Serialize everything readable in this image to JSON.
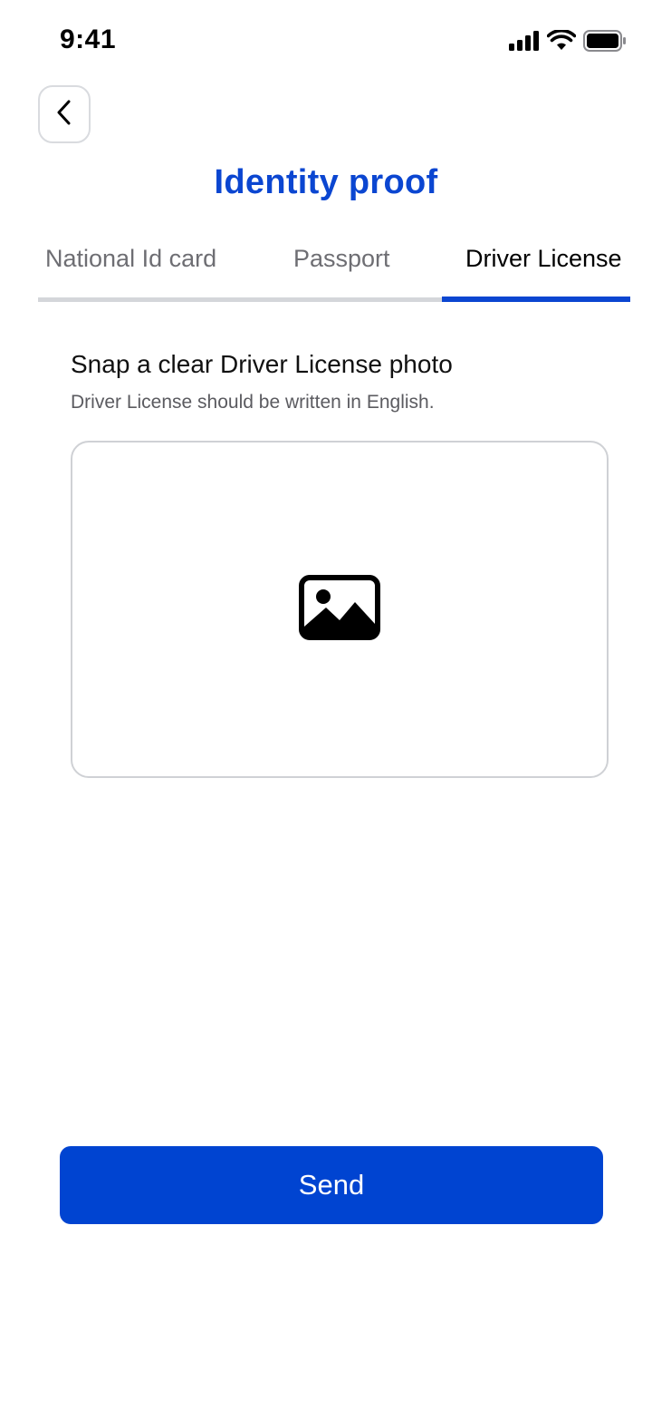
{
  "status_bar": {
    "time": "9:41",
    "icons": [
      "signal-icon",
      "wifi-icon",
      "battery-icon"
    ]
  },
  "header": {
    "back_icon": "chevron-left-icon",
    "title": "Identity proof"
  },
  "tabs": [
    {
      "label": "National Id card",
      "active": false
    },
    {
      "label": "Passport",
      "active": false
    },
    {
      "label": "Driver License",
      "active": true
    }
  ],
  "content": {
    "heading": "Snap a clear Driver License photo",
    "subtext": "Driver License should be written in English.",
    "upload_icon": "image-icon"
  },
  "actions": {
    "send_label": "Send"
  },
  "colors": {
    "accent": "#0b46d1",
    "button": "#0044d1",
    "inactive_tab": "#6e6e73",
    "border": "#cfd1d5"
  }
}
